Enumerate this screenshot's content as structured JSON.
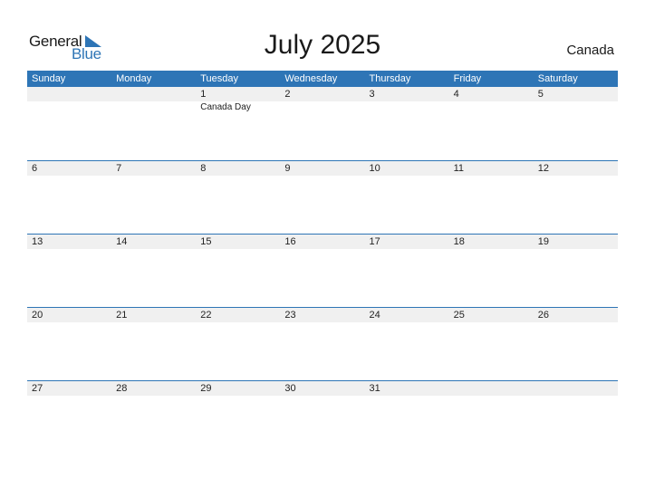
{
  "logo": {
    "word1": "General",
    "word2": "Blue"
  },
  "title": "July 2025",
  "country": "Canada",
  "accent_color": "#2e75b6",
  "weekdays": [
    "Sunday",
    "Monday",
    "Tuesday",
    "Wednesday",
    "Thursday",
    "Friday",
    "Saturday"
  ],
  "weeks": [
    {
      "days": [
        "",
        "",
        "1",
        "2",
        "3",
        "4",
        "5"
      ],
      "events": [
        "",
        "",
        "Canada Day",
        "",
        "",
        "",
        ""
      ]
    },
    {
      "days": [
        "6",
        "7",
        "8",
        "9",
        "10",
        "11",
        "12"
      ],
      "events": [
        "",
        "",
        "",
        "",
        "",
        "",
        ""
      ]
    },
    {
      "days": [
        "13",
        "14",
        "15",
        "16",
        "17",
        "18",
        "19"
      ],
      "events": [
        "",
        "",
        "",
        "",
        "",
        "",
        ""
      ]
    },
    {
      "days": [
        "20",
        "21",
        "22",
        "23",
        "24",
        "25",
        "26"
      ],
      "events": [
        "",
        "",
        "",
        "",
        "",
        "",
        ""
      ]
    },
    {
      "days": [
        "27",
        "28",
        "29",
        "30",
        "31",
        "",
        ""
      ],
      "events": [
        "",
        "",
        "",
        "",
        "",
        "",
        ""
      ]
    }
  ]
}
